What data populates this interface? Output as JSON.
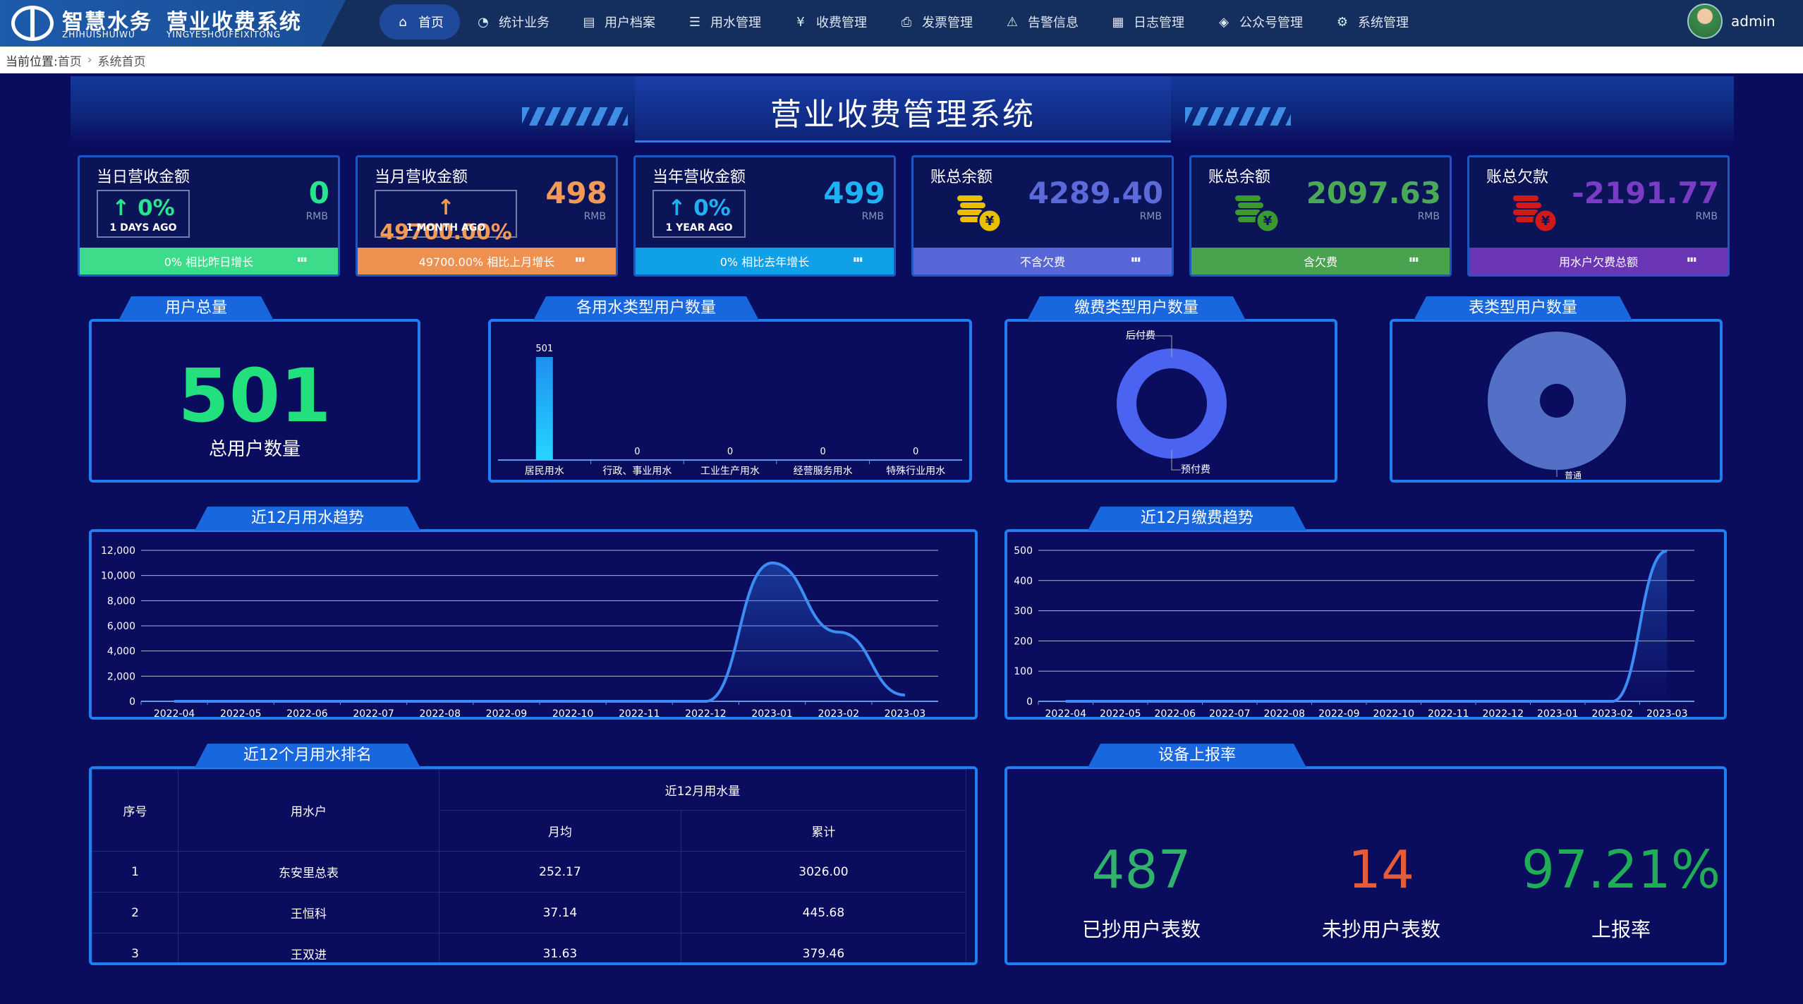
{
  "app": {
    "logo_cn": "智慧水务",
    "logo_en": "ZHIHUISHUIWU",
    "system_cn": "营业收费系统",
    "system_en": "YINGYESHOUFEIXITONG",
    "user": "admin"
  },
  "nav": [
    {
      "label": "首页",
      "icon": "home-icon",
      "active": true
    },
    {
      "label": "统计业务",
      "icon": "pie-chart-icon"
    },
    {
      "label": "用户档案",
      "icon": "file-icon"
    },
    {
      "label": "用水管理",
      "icon": "list-icon"
    },
    {
      "label": "收费管理",
      "icon": "yen-circle-icon"
    },
    {
      "label": "发票管理",
      "icon": "printer-icon"
    },
    {
      "label": "告警信息",
      "icon": "warning-icon"
    },
    {
      "label": "日志管理",
      "icon": "log-icon"
    },
    {
      "label": "公众号管理",
      "icon": "layers-icon"
    },
    {
      "label": "系统管理",
      "icon": "gear-icon"
    }
  ],
  "breadcrumb": {
    "prefix": "当前位置:",
    "items": [
      "首页",
      "系统首页"
    ]
  },
  "page_title": "营业收费管理系统",
  "cards": [
    {
      "label": "当日营收金额",
      "pct": "0%",
      "ago": "1 DAYS AGO",
      "value": "0",
      "unit": "RMB",
      "footer": "0% 相比昨日增长",
      "color": "#3ddc8a",
      "valcolor": "#27e58d"
    },
    {
      "label": "当月营收金额",
      "pct": "49700.00%",
      "ago": "1 MONTH AGO",
      "value": "498",
      "unit": "RMB",
      "footer": "49700.00% 相比上月增长",
      "color": "#ee9150",
      "valcolor": "#f49a55"
    },
    {
      "label": "当年营收金额",
      "pct": "0%",
      "ago": "1 YEAR AGO",
      "value": "499",
      "unit": "RMB",
      "footer": "0% 相比去年增长",
      "color": "#0fa0e8",
      "valcolor": "#1fb2f2"
    },
    {
      "label": "账总余额",
      "value": "4289.40",
      "unit": "RMB",
      "footer": "不含欠费",
      "color": "#5867d8",
      "valcolor": "#5b6ad8",
      "coin": "#e8c000"
    },
    {
      "label": "账总余额",
      "value": "2097.63",
      "unit": "RMB",
      "footer": "含欠费",
      "color": "#49a24e",
      "valcolor": "#4aa957",
      "coin": "#3a9a30"
    },
    {
      "label": "账总欠款",
      "value": "-2191.77",
      "unit": "RMB",
      "footer": "用水户欠费总额",
      "color": "#6b36b5",
      "valcolor": "#7a3bc5",
      "coin": "#d01a1a"
    }
  ],
  "user_total": {
    "title": "用户总量",
    "value": "501",
    "label": "总用户数量"
  },
  "water_types": {
    "title": "各用水类型用户数量"
  },
  "pay_types": {
    "title": "缴费类型用户数量",
    "labels": [
      "后付费",
      "预付费"
    ]
  },
  "meter_types": {
    "title": "表类型用户数量",
    "labels": [
      "普通"
    ]
  },
  "usage_trend": {
    "title": "近12月用水趋势"
  },
  "pay_trend": {
    "title": "近12月缴费趋势"
  },
  "ranking": {
    "title": "近12个月用水排名",
    "headers": {
      "index": "序号",
      "user": "用水户",
      "group": "近12月用水量",
      "avg": "月均",
      "total": "累计"
    },
    "rows": [
      {
        "index": "1",
        "user": "东安里总表",
        "avg": "252.17",
        "total": "3026.00"
      },
      {
        "index": "2",
        "user": "王恒科",
        "avg": "37.14",
        "total": "445.68"
      },
      {
        "index": "3",
        "user": "王双进",
        "avg": "31.63",
        "total": "379.46"
      }
    ]
  },
  "report": {
    "title": "设备上报率",
    "items": [
      {
        "value": "487",
        "label": "已抄用户表数",
        "color": "#31b26a"
      },
      {
        "value": "14",
        "label": "未抄用户表数",
        "color": "#e35d3a"
      },
      {
        "value": "97.21%",
        "label": "上报率",
        "color": "#1fae55"
      }
    ]
  },
  "chart_data": [
    {
      "type": "bar",
      "title": "各用水类型用户数量",
      "categories": [
        "居民用水",
        "行政、事业用水",
        "工业生产用水",
        "经营服务用水",
        "特殊行业用水"
      ],
      "values": [
        501,
        0,
        0,
        0,
        0
      ]
    },
    {
      "type": "pie",
      "title": "缴费类型用户数量",
      "categories": [
        "后付费",
        "预付费"
      ],
      "values": [
        1,
        500
      ]
    },
    {
      "type": "pie",
      "title": "表类型用户数量",
      "categories": [
        "普通"
      ],
      "values": [
        501
      ]
    },
    {
      "type": "line",
      "title": "近12月用水趋势",
      "x": [
        "2022-04",
        "2022-05",
        "2022-06",
        "2022-07",
        "2022-08",
        "2022-09",
        "2022-10",
        "2022-11",
        "2022-12",
        "2023-01",
        "2023-02",
        "2023-03"
      ],
      "y": [
        0,
        0,
        0,
        0,
        0,
        0,
        0,
        0,
        0,
        11000,
        5500,
        500
      ],
      "ylim": [
        0,
        12000
      ],
      "yticks": [
        "0",
        "2,000",
        "4,000",
        "6,000",
        "8,000",
        "10,000",
        "12,000"
      ]
    },
    {
      "type": "line",
      "title": "近12月缴费趋势",
      "x": [
        "2022-04",
        "2022-05",
        "2022-06",
        "2022-07",
        "2022-08",
        "2022-09",
        "2022-10",
        "2022-11",
        "2022-12",
        "2023-01",
        "2023-02",
        "2023-03"
      ],
      "y": [
        0,
        0,
        0,
        0,
        0,
        0,
        0,
        0,
        0,
        0,
        0,
        498
      ],
      "ylim": [
        0,
        500
      ],
      "yticks": [
        "0",
        "100",
        "200",
        "300",
        "400",
        "500"
      ]
    }
  ]
}
